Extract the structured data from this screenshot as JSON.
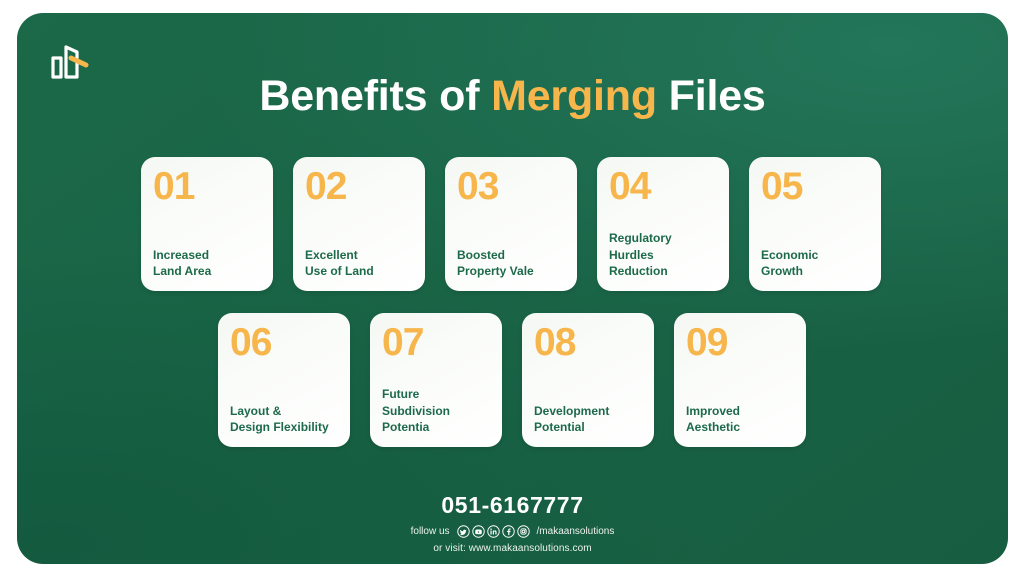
{
  "brand": {
    "logo_icon": "building-logo-icon",
    "accent_color": "#f7b64c",
    "panel_color": "#1a6446",
    "card_text_color": "#1d6a4a"
  },
  "title": {
    "part1": "Benefits of ",
    "accent": "Merging",
    "part2": " Files"
  },
  "cards_row1": [
    {
      "number": "01",
      "label": "Increased\nLand Area"
    },
    {
      "number": "02",
      "label": "Excellent\nUse of Land"
    },
    {
      "number": "03",
      "label": "Boosted\nProperty Vale"
    },
    {
      "number": "04",
      "label": "Regulatory\nHurdles\nReduction"
    },
    {
      "number": "05",
      "label": "Economic\nGrowth"
    }
  ],
  "cards_row2": [
    {
      "number": "06",
      "label": "Layout &\nDesign Flexibility"
    },
    {
      "number": "07",
      "label": "Future\nSubdivision\nPotentia"
    },
    {
      "number": "08",
      "label": "Development\nPotential"
    },
    {
      "number": "09",
      "label": "Improved\nAesthetic"
    }
  ],
  "footer": {
    "phone": "051-6167777",
    "follow_label": "follow us",
    "handle": "/makaansolutions",
    "website": "or visit: www.makaansolutions.com",
    "social": [
      {
        "name": "twitter-icon"
      },
      {
        "name": "youtube-icon"
      },
      {
        "name": "linkedin-icon"
      },
      {
        "name": "facebook-icon"
      },
      {
        "name": "instagram-icon"
      }
    ]
  }
}
